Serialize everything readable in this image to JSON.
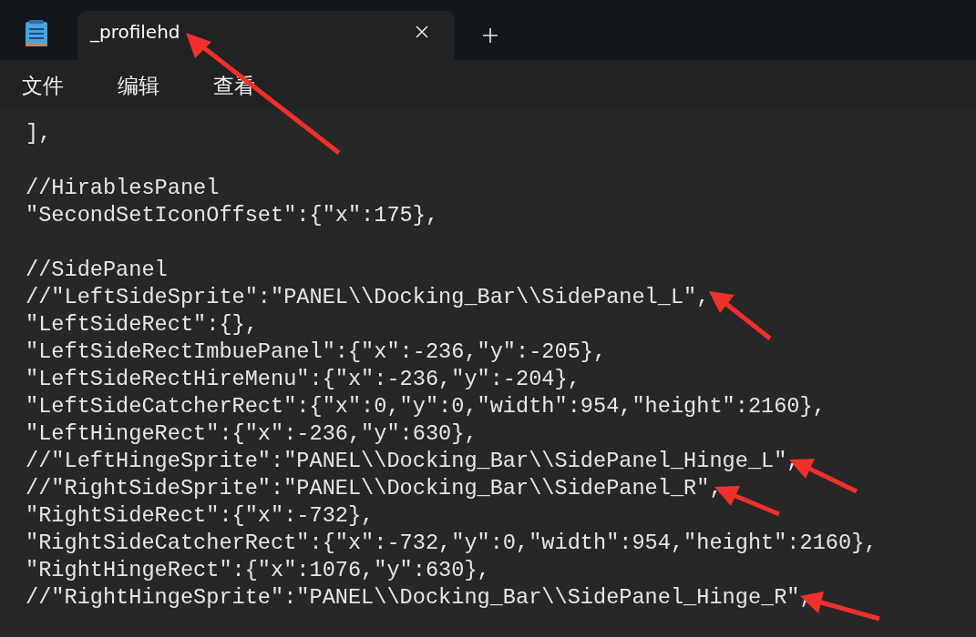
{
  "tabs": [
    {
      "title": "_profilehd",
      "selected": true
    }
  ],
  "menu": [
    "文件",
    "编辑",
    "查看"
  ],
  "editor": {
    "lines": [
      {
        "kind": "code",
        "text": "],"
      },
      {
        "kind": "blank"
      },
      {
        "kind": "code",
        "text": "//HirablesPanel"
      },
      {
        "kind": "code",
        "text": "\"SecondSetIconOffset\":{\"x\":175},"
      },
      {
        "kind": "blank"
      },
      {
        "kind": "code",
        "text": "//SidePanel"
      },
      {
        "kind": "code",
        "text": "//\"LeftSideSprite\":\"PANEL\\\\Docking_Bar\\\\SidePanel_L\","
      },
      {
        "kind": "code",
        "text": "\"LeftSideRect\":{},"
      },
      {
        "kind": "code",
        "text": "\"LeftSideRectImbuePanel\":{\"x\":-236,\"y\":-205},"
      },
      {
        "kind": "code",
        "text": "\"LeftSideRectHireMenu\":{\"x\":-236,\"y\":-204},"
      },
      {
        "kind": "code",
        "text": "\"LeftSideCatcherRect\":{\"x\":0,\"y\":0,\"width\":954,\"height\":2160},"
      },
      {
        "kind": "code",
        "text": "\"LeftHingeRect\":{\"x\":-236,\"y\":630},"
      },
      {
        "kind": "code",
        "text": "//\"LeftHingeSprite\":\"PANEL\\\\Docking_Bar\\\\SidePanel_Hinge_L\","
      },
      {
        "kind": "code",
        "text": "//\"RightSideSprite\":\"PANEL\\\\Docking_Bar\\\\SidePanel_R\","
      },
      {
        "kind": "code",
        "text": "\"RightSideRect\":{\"x\":-732},"
      },
      {
        "kind": "code",
        "text": "\"RightSideCatcherRect\":{\"x\":-732,\"y\":0,\"width\":954,\"height\":2160},"
      },
      {
        "kind": "code",
        "text": "\"RightHingeRect\":{\"x\":1076,\"y\":630},"
      },
      {
        "kind": "code",
        "text": "//\"RightHingeSprite\":\"PANEL\\\\Docking_Bar\\\\SidePanel_Hinge_R\","
      }
    ]
  }
}
